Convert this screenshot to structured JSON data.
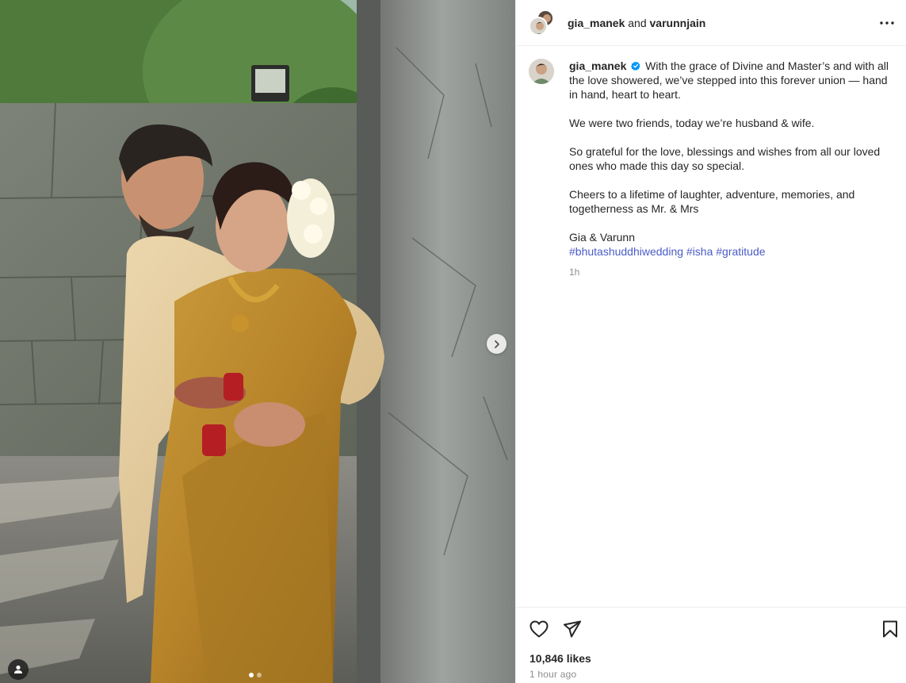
{
  "header": {
    "author1": "gia_manek",
    "conjunction": " and ",
    "author2": "varunnjain"
  },
  "caption": {
    "username": "gia_manek",
    "line1": "With the grace of Divine and Master’s and with all the love showered, we’ve stepped into this forever union — hand in hand, heart to heart.",
    "line2": "We were two friends, today we’re husband & wife.",
    "line3": "So grateful for the love, blessings and wishes from all our loved ones who made this day so special.",
    "line4": "Cheers to a lifetime of laughter, adventure, memories, and togetherness as Mr. & Mrs",
    "signature": "Gia & Varunn",
    "hashtags": [
      "#bhutashuddhiwedding",
      "#isha",
      "#gratitude"
    ],
    "relative_time": "1h"
  },
  "engagement": {
    "likes": "10,846 likes",
    "posted": "1 hour ago"
  },
  "carousel": {
    "slide_count": 2,
    "current_slide": 1
  },
  "icons": {
    "more": "more-options-icon",
    "like": "heart-icon",
    "share": "paper-plane-icon",
    "save": "bookmark-icon",
    "verified": "verified-badge-icon",
    "next": "chevron-right-icon",
    "tags": "user-tag-icon"
  },
  "colors": {
    "verified": "#0095f6",
    "hashtag": "#3f51b5",
    "secondary_text": "#8e8e8e",
    "divider": "#efefef"
  }
}
